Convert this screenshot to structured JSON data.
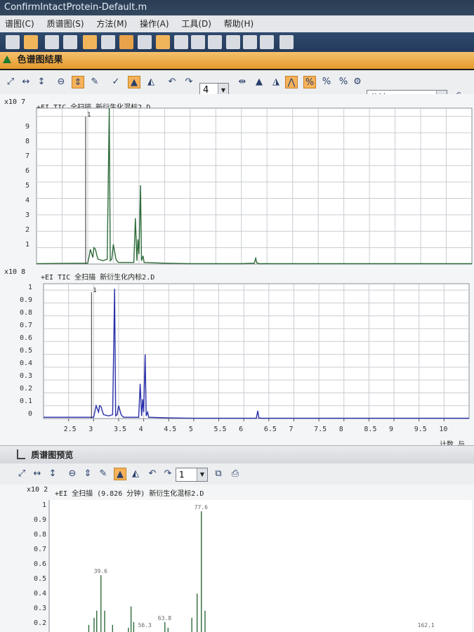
{
  "window": {
    "title": "ConfirmIntactProtein-Default.m"
  },
  "menu": [
    "谱图(C)",
    "质谱图(S)",
    "方法(M)",
    "操作(A)",
    "工具(D)",
    "帮助(H)"
  ],
  "chromatogram_panel": {
    "title": "色谱图结果"
  },
  "toolbar2": {
    "zoom_value": "4",
    "unit_value": "分钟"
  },
  "plot1": {
    "scale": "x10 7",
    "title": "+EI TIC 全扫描  新衍生化混标2.D",
    "peak_label": "1",
    "yticks": [
      "9",
      "8",
      "7",
      "6",
      "5",
      "4",
      "3",
      "2",
      "1"
    ]
  },
  "plot2": {
    "scale": "x10 8",
    "title": "+EI TIC 全扫描  新衍生化内标2.D",
    "peak_label": "1",
    "yticks": [
      "1",
      "0.9",
      "0.8",
      "0.7",
      "0.6",
      "0.5",
      "0.4",
      "0.3",
      "0.2",
      "0.1",
      "0"
    ],
    "xticks": [
      "2.5",
      "3",
      "3.5",
      "4",
      "4.5",
      "5",
      "5.5",
      "6",
      "6.5",
      "7",
      "7.5",
      "8",
      "8.5",
      "9",
      "9.5",
      "10"
    ],
    "xaxis_label": "计数 与 采"
  },
  "spectrum_panel": {
    "title": "质谱图预览",
    "zoom_value": "1"
  },
  "plot3": {
    "scale": "x10 2",
    "title": "+EI 全扫描 (9.826 分钟) 新衍生化混标2.D",
    "yticks": [
      "1",
      "0.9",
      "0.8",
      "0.7",
      "0.6",
      "0.5",
      "0.4",
      "0.3",
      "0.2"
    ],
    "peak_labels": [
      "77.6",
      "39.6",
      "63.8",
      "56.3",
      "162.1"
    ]
  },
  "colors": {
    "plot1_line": "#2e6b3a",
    "plot2_line": "#2a2fa8",
    "plot3_line": "#2e6b3a",
    "grid": "#c9ccd1",
    "toolbar_selected": "#f5b25a",
    "header_orange": "#e79a2c"
  },
  "chart_data": [
    {
      "type": "line",
      "title": "+EI TIC 全扫描  新衍生化混标2.D",
      "ylabel": "x10 7",
      "xlabel": "",
      "ylim": [
        0,
        9.5
      ],
      "xlim": [
        2.0,
        10.5
      ],
      "grid": true,
      "series": [
        {
          "name": "",
          "x": [
            2.0,
            3.0,
            3.03,
            3.05,
            3.1,
            3.12,
            3.15,
            3.18,
            3.2,
            3.3,
            3.38,
            3.42,
            3.44,
            3.47,
            3.5,
            3.55,
            3.57,
            3.6,
            3.7,
            3.9,
            3.93,
            3.96,
            3.98,
            4.0,
            4.03,
            4.05,
            4.08,
            4.1,
            4.5,
            5.0,
            6.0,
            6.25,
            6.28,
            6.3,
            6.35,
            7.0,
            8.0,
            9.0,
            10.0,
            10.5
          ],
          "y": [
            0.02,
            0.05,
            0.5,
            0.9,
            0.4,
            1.0,
            0.9,
            0.5,
            0.3,
            0.2,
            0.3,
            9.6,
            0.2,
            0.3,
            1.2,
            0.3,
            0.2,
            0.1,
            0.1,
            0.1,
            2.8,
            0.2,
            1.5,
            0.6,
            4.8,
            0.2,
            0.5,
            0.1,
            0.05,
            0.02,
            0.02,
            0.05,
            0.35,
            0.08,
            0.02,
            0.02,
            0.02,
            0.02,
            0.02,
            0.02
          ]
        }
      ]
    },
    {
      "type": "line",
      "title": "+EI TIC 全扫描  新衍生化内标2.D",
      "ylabel": "x10 8",
      "xlabel": "计数 与 采",
      "ylim": [
        0,
        1.05
      ],
      "xlim": [
        2.0,
        10.5
      ],
      "grid": true,
      "series": [
        {
          "name": "",
          "x": [
            2.0,
            3.0,
            3.03,
            3.05,
            3.1,
            3.12,
            3.15,
            3.18,
            3.2,
            3.3,
            3.38,
            3.42,
            3.44,
            3.47,
            3.5,
            3.55,
            3.57,
            3.6,
            3.7,
            3.9,
            3.93,
            3.96,
            3.98,
            4.0,
            4.03,
            4.05,
            4.08,
            4.1,
            4.5,
            5.0,
            6.0,
            6.25,
            6.28,
            6.3,
            6.35,
            7.0,
            8.0,
            9.0,
            10.0,
            10.5
          ],
          "y": [
            0.01,
            0.01,
            0.06,
            0.1,
            0.05,
            0.1,
            0.09,
            0.05,
            0.03,
            0.02,
            0.03,
            1.01,
            0.02,
            0.03,
            0.1,
            0.03,
            0.02,
            0.01,
            0.01,
            0.01,
            0.27,
            0.02,
            0.15,
            0.05,
            0.5,
            0.02,
            0.05,
            0.01,
            0.005,
            0.002,
            0.002,
            0.003,
            0.06,
            0.005,
            0.002,
            0.002,
            0.002,
            0.002,
            0.002,
            0.002
          ]
        }
      ]
    },
    {
      "type": "bar",
      "title": "+EI 全扫描 (9.826 分钟) 新衍生化混标2.D",
      "ylabel": "x10 2",
      "xlabel": "",
      "ylim": [
        0.15,
        1.05
      ],
      "xlim": [
        20,
        180
      ],
      "grid": false,
      "x": [
        35,
        37,
        38,
        39.6,
        41,
        44,
        50,
        51,
        52,
        63.8,
        65,
        74,
        76,
        77.6,
        79
      ],
      "values": [
        0.2,
        0.25,
        0.3,
        0.55,
        0.3,
        0.2,
        0.18,
        0.33,
        0.22,
        0.22,
        0.18,
        0.25,
        0.42,
        1.0,
        0.3
      ]
    }
  ]
}
